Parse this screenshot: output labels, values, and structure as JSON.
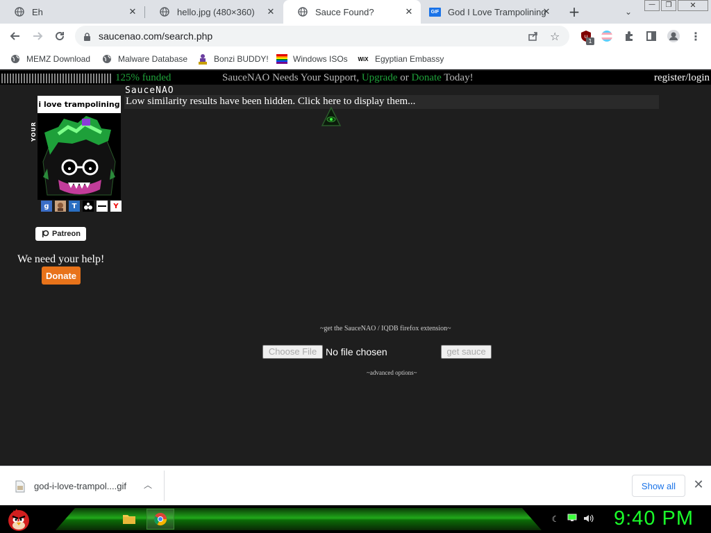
{
  "browser": {
    "tabs": [
      {
        "title": "Eh",
        "icon": "globe-icon",
        "active": false
      },
      {
        "title": "hello.jpg (480×360)",
        "icon": "globe-icon",
        "active": false
      },
      {
        "title": "Sauce Found?",
        "icon": "globe-icon",
        "active": true
      },
      {
        "title": "God I Love Trampolining",
        "icon": "gif-icon",
        "active": false
      }
    ],
    "gif_badge": "GIF",
    "url": "saucenao.com/search.php",
    "extension_badge": "1",
    "bookmarks": [
      {
        "label": "MEMZ Download",
        "icon": "globe-icon"
      },
      {
        "label": "Malware Database",
        "icon": "globe-icon"
      },
      {
        "label": "Bonzi BUDDY!",
        "icon": "bonzi-icon"
      },
      {
        "label": "Windows ISOs",
        "icon": "windows-flag-icon"
      },
      {
        "label": "Egyptian Embassy",
        "icon": "wix-icon"
      }
    ],
    "wix_label": "WiX"
  },
  "page": {
    "funded": "125% funded",
    "support_text_1": "SauceNAO Needs Your Support,",
    "upgrade": "Upgrade",
    "or": "or",
    "donate_link": "Donate",
    "today": "Today!",
    "register_login": "register/login",
    "your_image_label": "YOUR IMAGE",
    "thumbnail_caption": "i love trampolining",
    "search_icons": [
      "google-icon",
      "ascii2d-icon",
      "tineye-icon",
      "bing-icon",
      "yandex-flat-icon",
      "yandex-icon"
    ],
    "tineye_letter": "T",
    "yandex_letter": "Y",
    "google_letter": "g",
    "patreon_label": "Patreon",
    "need_help": "We need your help!",
    "donate_button": "Donate",
    "site_title": "SauceNAO",
    "hidden_message": "Low similarity results have been hidden. Click here to display them...",
    "extension_link": "~get the SauceNAO / IQDB firefox extension~",
    "choose_file": "Choose File",
    "no_file": "No file chosen",
    "get_sauce": "get sauce",
    "advanced_options": "~advanced options~"
  },
  "downloads": {
    "filename": "god-i-love-trampol....gif",
    "show_all": "Show all"
  },
  "taskbar": {
    "clock": "9:40 PM"
  },
  "colors": {
    "page_bg": "#1e1e1e",
    "funded_green": "#1fa23a",
    "donate_orange": "#e8731a",
    "clock_green": "#1aff2a",
    "chrome_accent": "#1a73e8"
  }
}
